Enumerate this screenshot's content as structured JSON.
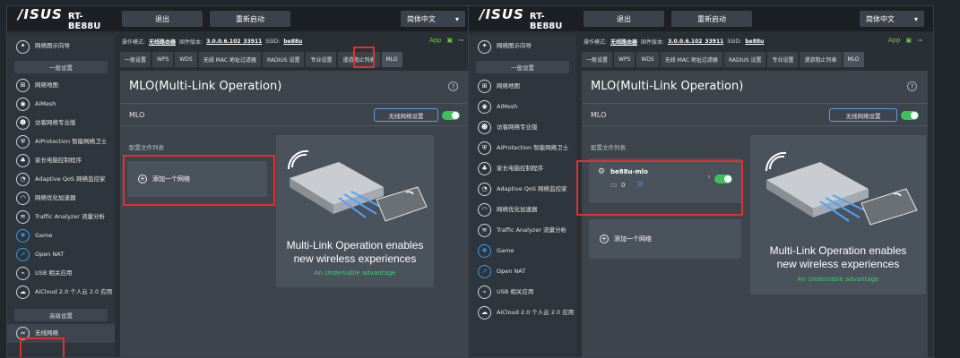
{
  "header": {
    "logo": "/ISUS",
    "model": "RT-BE88U",
    "logout": "退出",
    "reboot": "重新启动",
    "language": "简体中文"
  },
  "sidebar": {
    "top_item": "网络图示向导",
    "general_header": "一般设置",
    "items": [
      {
        "label": "网络地图",
        "icon": "map-icon"
      },
      {
        "label": "AiMesh",
        "icon": "mesh-icon"
      },
      {
        "label": "访客网络专业版",
        "icon": "guest-icon"
      },
      {
        "label": "AiProtection 智能网络卫士",
        "icon": "shield-icon"
      },
      {
        "label": "家长电脑控制程序",
        "icon": "family-icon"
      },
      {
        "label": "Adaptive QoS 网络监控家",
        "icon": "qos-icon"
      },
      {
        "label": "网络优化加速器",
        "icon": "gauge-icon"
      },
      {
        "label": "Traffic Analyzer 流量分析",
        "icon": "traffic-icon"
      },
      {
        "label": "Game",
        "icon": "gamepad-icon"
      },
      {
        "label": "Open NAT",
        "icon": "rocket-icon"
      },
      {
        "label": "USB 相关应用",
        "icon": "usb-icon"
      },
      {
        "label": "AiCloud 2.0 个人云 2.0 应用",
        "icon": "cloud-icon"
      }
    ],
    "advanced_header": "高级设置",
    "wireless_item": "无线网络"
  },
  "status": {
    "op_mode_label": "操作模式:",
    "op_mode_value": "无线路由器",
    "firmware_label": "固件版本:",
    "firmware_value": "3.0.0.6.102_33911",
    "ssid_label": "SSID:",
    "ssid_value": "be88u",
    "app_label": "App"
  },
  "tabs": [
    "一般设置",
    "WPS",
    "WDS",
    "无线 MAC 地址过滤器",
    "RADIUS 设置",
    "专业设置",
    "漫游阻止列表",
    "MLO"
  ],
  "panel": {
    "title": "MLO(Multi-Link Operation)",
    "mlo_label": "MLO",
    "wifi_settings_button": "无线网络设置",
    "profile_list_label": "配置文件列表",
    "add_network_label": "添加一个网络",
    "profile_name": "be88u-mlo",
    "profile_clients": "0",
    "promo_line1": "Multi-Link Operation enables",
    "promo_line2": "new wireless experiences",
    "promo_tagline": "An Undeniable advantage"
  },
  "colors": {
    "highlight": "#e0312b",
    "toggle_on": "#3cc25c",
    "accent_blue": "#5aa0e6",
    "tagline_green": "#3cd070"
  }
}
